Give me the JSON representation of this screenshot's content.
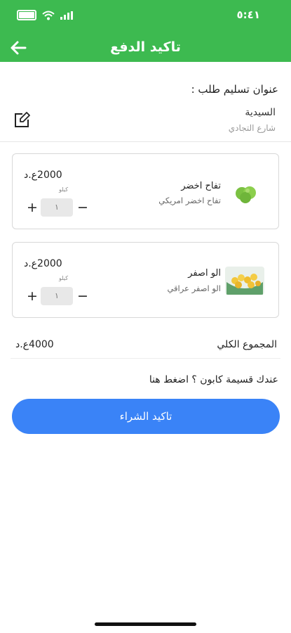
{
  "status_bar": {
    "time": "٥:٤١"
  },
  "header": {
    "title": "تاكيد الدفع"
  },
  "address": {
    "label": "عنوان تسليم طلب :",
    "name": "السيدية",
    "street": "شارع التجادي"
  },
  "cart": {
    "items": [
      {
        "name": "تفاح اخضر",
        "description": "تفاح اخضر امريكي",
        "price": "2000ع.د",
        "unit": "كيلو",
        "quantity": "١",
        "icon": "green-apple-image"
      },
      {
        "name": "الو اصفر",
        "description": "الو اصفر عراقي",
        "price": "2000ع.د",
        "unit": "كيلو",
        "quantity": "١",
        "icon": "yellow-plum-image"
      }
    ],
    "stepper": {
      "plus": "+",
      "minus": "−"
    }
  },
  "summary": {
    "total_label": "المجموع الكلي",
    "total_value": "4000ع.د"
  },
  "coupon_text": "عندك قسيمة كابون ؟ اضغط هنا",
  "buy_button": "تاكيد الشراء",
  "colors": {
    "header": "#3dba50",
    "primary_button": "#3a83f7"
  }
}
